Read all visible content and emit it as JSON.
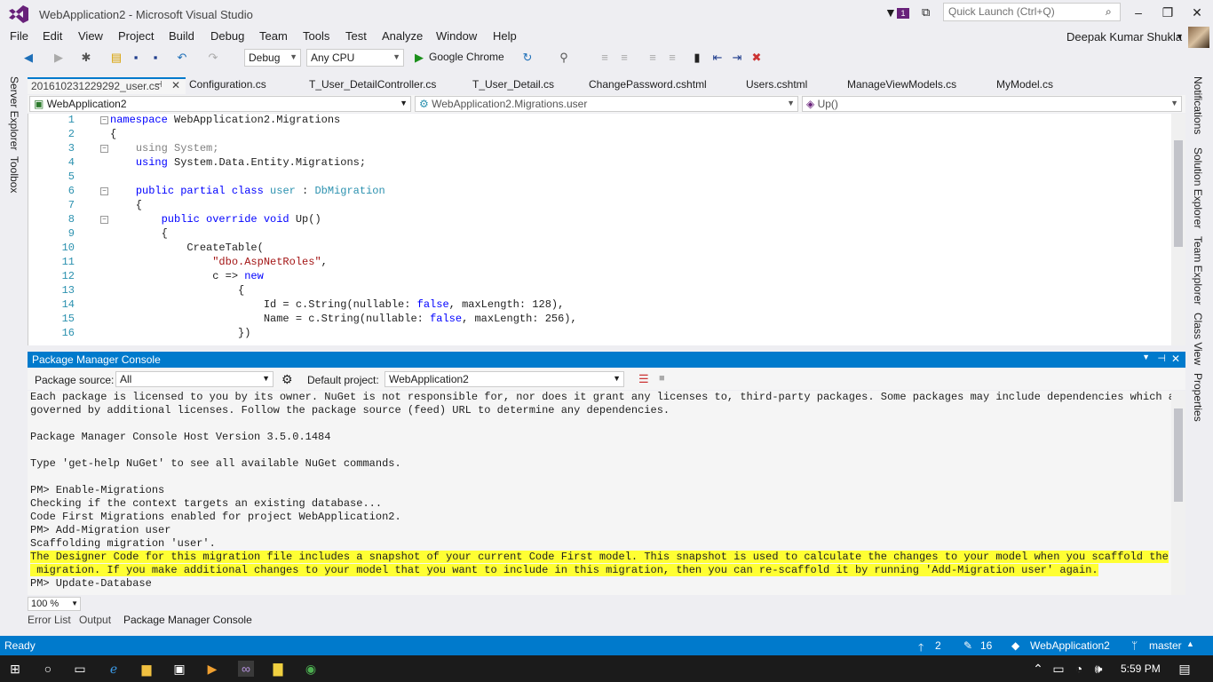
{
  "window": {
    "title": "WebApplication2 - Microsoft Visual Studio",
    "quick_launch_placeholder": "Quick Launch (Ctrl+Q)",
    "notification_count": "1"
  },
  "menu": [
    "File",
    "Edit",
    "View",
    "Project",
    "Build",
    "Debug",
    "Team",
    "Tools",
    "Test",
    "Analyze",
    "Window",
    "Help"
  ],
  "user": {
    "name": "Deepak Kumar Shukla"
  },
  "toolbar": {
    "config": "Debug",
    "platform": "Any CPU",
    "browser": "Google Chrome"
  },
  "tabs": [
    "201610231229292_user.cs",
    "Configuration.cs",
    "T_User_DetailController.cs",
    "T_User_Detail.cs",
    "ChangePassword.cshtml",
    "Users.cshtml",
    "ManageViewModels.cs",
    "MyModel.cs"
  ],
  "navbar": {
    "project": "WebApplication2",
    "type": "WebApplication2.Migrations.user",
    "member": "Up()"
  },
  "editor": {
    "lines": [
      {
        "n": "1",
        "t": "namespace WebApplication2.Migrations"
      },
      {
        "n": "2",
        "t": "{"
      },
      {
        "n": "3",
        "t": "    using System;"
      },
      {
        "n": "4",
        "t": "    using System.Data.Entity.Migrations;"
      },
      {
        "n": "5",
        "t": ""
      },
      {
        "n": "6",
        "t": "    public partial class user : DbMigration"
      },
      {
        "n": "7",
        "t": "    {"
      },
      {
        "n": "8",
        "t": "        public override void Up()"
      },
      {
        "n": "9",
        "t": "        {"
      },
      {
        "n": "10",
        "t": "            CreateTable("
      },
      {
        "n": "11",
        "t": "                \"dbo.AspNetRoles\","
      },
      {
        "n": "12",
        "t": "                c => new"
      },
      {
        "n": "13",
        "t": "                    {"
      },
      {
        "n": "14",
        "t": "                        Id = c.String(nullable: false, maxLength: 128),"
      },
      {
        "n": "15",
        "t": "                        Name = c.String(nullable: false, maxLength: 256),"
      },
      {
        "n": "16",
        "t": "                    })"
      }
    ]
  },
  "side_panels": {
    "left": [
      "Server Explorer",
      "Toolbox"
    ],
    "right": [
      "Notifications",
      "Solution Explorer",
      "Team Explorer",
      "Class View",
      "Properties"
    ]
  },
  "pmc": {
    "title": "Package Manager Console",
    "source_label": "Package source:",
    "source_value": "All",
    "project_label": "Default project:",
    "project_value": "WebApplication2",
    "lines": [
      "Each package is licensed to you by its owner. NuGet is not responsible for, nor does it grant any licenses to, third-party packages. Some packages may include dependencies which are",
      "governed by additional licenses. Follow the package source (feed) URL to determine any dependencies.",
      "",
      "Package Manager Console Host Version 3.5.0.1484",
      "",
      "Type 'get-help NuGet' to see all available NuGet commands.",
      "",
      "PM> Enable-Migrations",
      "Checking if the context targets an existing database...",
      "Code First Migrations enabled for project WebApplication2.",
      "PM> Add-Migration user",
      "Scaffolding migration 'user'."
    ],
    "highlight_lines": [
      "The Designer Code for this migration file includes a snapshot of your current Code First model. This snapshot is used to calculate the changes to your model when you scaffold the next",
      " migration. If you make additional changes to your model that you want to include in this migration, then you can re-scaffold it by running 'Add-Migration user' again."
    ],
    "prompt": "PM> Update-Database",
    "zoom": "100 %"
  },
  "bottom_tabs": [
    "Error List",
    "Output",
    "Package Manager Console"
  ],
  "status": {
    "text": "Ready",
    "up_count": "2",
    "edit_count": "16",
    "repo": "WebApplication2",
    "branch": "master"
  },
  "taskbar": {
    "time": "5:59 PM"
  },
  "colors": {
    "accent": "#007acc",
    "highlight": "#ffff33",
    "vs_purple": "#68217a"
  }
}
